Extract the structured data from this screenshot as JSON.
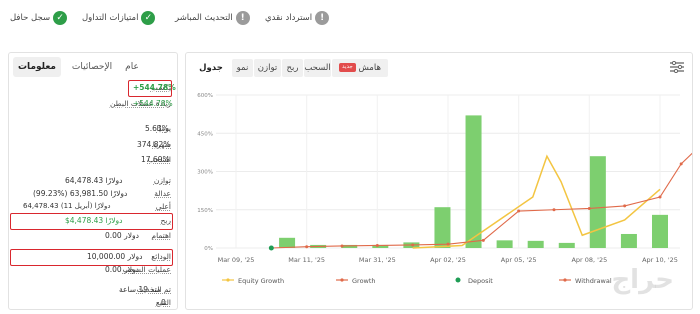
{
  "badges": [
    {
      "label": "سجل حافل",
      "icon": "check-icon",
      "status": "green"
    },
    {
      "label": "امتيازات التداول",
      "icon": "check-icon",
      "status": "green"
    },
    {
      "label": "التحديث المباشر",
      "icon": "exclamation-icon",
      "status": "gray"
    },
    {
      "label": "استرداد نقدي",
      "icon": "exclamation-icon",
      "status": "gray"
    }
  ],
  "stats": {
    "tabs": [
      "عام",
      "الإحصائيات",
      "معلومات"
    ],
    "rows": [
      {
        "label": "يكسب",
        "value": "+544.78%",
        "color": "#2e9e48"
      },
      {
        "label": "زيادة عضلات البطن",
        "value": "+544.78%",
        "color": "#2e9e48"
      },
      {
        "label": "يوميًا",
        "value": "5.63%"
      },
      {
        "label": "شهريا",
        "value": "374.82%"
      },
      {
        "label": "السحب",
        "value": "17.69%"
      },
      {
        "label": "توازن",
        "value": "64,478.43 دولارًا"
      },
      {
        "label": "عدالة",
        "value": "(99.23%) 63,981.50 دولارًا"
      },
      {
        "label": "أعلى",
        "value": "64,478.43 دولارًا (أبريل 11)"
      },
      {
        "label": "ربح",
        "value": "$4,478.43 دولارًا",
        "color": "#2e9e48"
      },
      {
        "label": "اهتمام",
        "value": "0.00 دولار"
      },
      {
        "label": "الودائع",
        "value": "10,000.00 دولار"
      },
      {
        "label": "عمليات السحب",
        "value": "0.00 دولار"
      },
      {
        "label": "تم التحديث",
        "value": "منذ 19 ساعة"
      },
      {
        "label": "التتبع",
        "value": "0"
      }
    ]
  },
  "chart_tabs": [
    {
      "label": "جدول",
      "active": true
    },
    {
      "label": "نمو",
      "active": false
    },
    {
      "label": "توازن",
      "active": false
    },
    {
      "label": "ربح",
      "active": false
    },
    {
      "label": "السحب",
      "active": false
    },
    {
      "label": "هامش",
      "active": false,
      "tag": "جديد"
    }
  ],
  "watermark": "حراج",
  "chart_data": {
    "type": "bar+line",
    "x_ticks": [
      "Mar 09, '25",
      "Mar 11, '25",
      "Mar 31, '25",
      "Apr 02, '25",
      "Apr 05, '25",
      "Apr 08, '25",
      "Apr 10, '25"
    ],
    "y_ticks": [
      "0%",
      "150%",
      "300%",
      "450%",
      "600%"
    ],
    "ylim": [
      0,
      600
    ],
    "bars": [
      0,
      40,
      12,
      12,
      12,
      22,
      160,
      520,
      30,
      28,
      20,
      360,
      55,
      130
    ],
    "series": [
      {
        "name": "Equity Growth",
        "color": "#f3c542",
        "points": [
          [
            2.5,
            0
          ],
          [
            3.2,
            10
          ],
          [
            4.2,
            200
          ],
          [
            4.4,
            360
          ],
          [
            4.6,
            260
          ],
          [
            4.9,
            50
          ],
          [
            5.5,
            110
          ],
          [
            6.0,
            230
          ]
        ]
      },
      {
        "name": "Growth",
        "color": "#e06a4a",
        "points": [
          [
            0.5,
            0
          ],
          [
            1.0,
            5
          ],
          [
            1.5,
            8
          ],
          [
            2.0,
            10
          ],
          [
            2.5,
            12
          ],
          [
            3.0,
            15
          ],
          [
            3.5,
            30
          ],
          [
            4.0,
            145
          ],
          [
            4.5,
            150
          ],
          [
            5.0,
            155
          ],
          [
            5.5,
            165
          ],
          [
            6.0,
            200
          ],
          [
            6.3,
            330
          ],
          [
            6.6,
            410
          ],
          [
            7.0,
            540
          ]
        ]
      },
      {
        "name": "Deposit",
        "color": "#1f9d55",
        "points": [
          [
            0.5,
            0
          ]
        ]
      },
      {
        "name": "Withdrawal",
        "color": "#e06a4a",
        "points": []
      }
    ]
  }
}
